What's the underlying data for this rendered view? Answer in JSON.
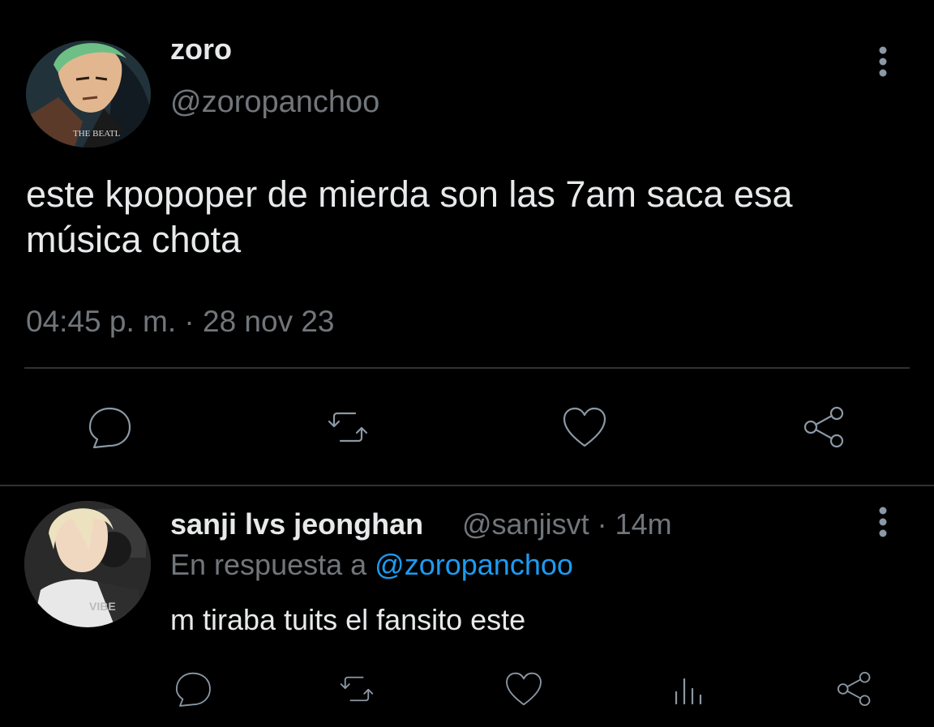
{
  "tweet": {
    "author_name": "zoro",
    "author_handle": "@zoropanchoo",
    "avatar_text": "THE BEATL",
    "text": "este kpopoper de mierda son las 7am saca esa música chota",
    "timestamp": "04:45 p. m. · 28 nov 23",
    "actions": [
      "comment-icon",
      "retweet-icon",
      "like-icon",
      "share-icon"
    ]
  },
  "reply": {
    "author_name": "sanji lvs jeonghan",
    "author_handle": "@sanjisvt · 14m",
    "replying_prefix": "En respuesta a",
    "replying_mention": "@zoropanchoo",
    "avatar_text": "VIBE",
    "text": "m tiraba tuits el fansito este",
    "actions": [
      "comment-icon",
      "retweet-icon",
      "like-icon",
      "analytics-icon",
      "share-icon"
    ]
  },
  "colors": {
    "background": "#000000",
    "text": "#e7e9ea",
    "secondary": "#71767b",
    "accent": "#1d9bf0",
    "divider": "#2f3336"
  }
}
